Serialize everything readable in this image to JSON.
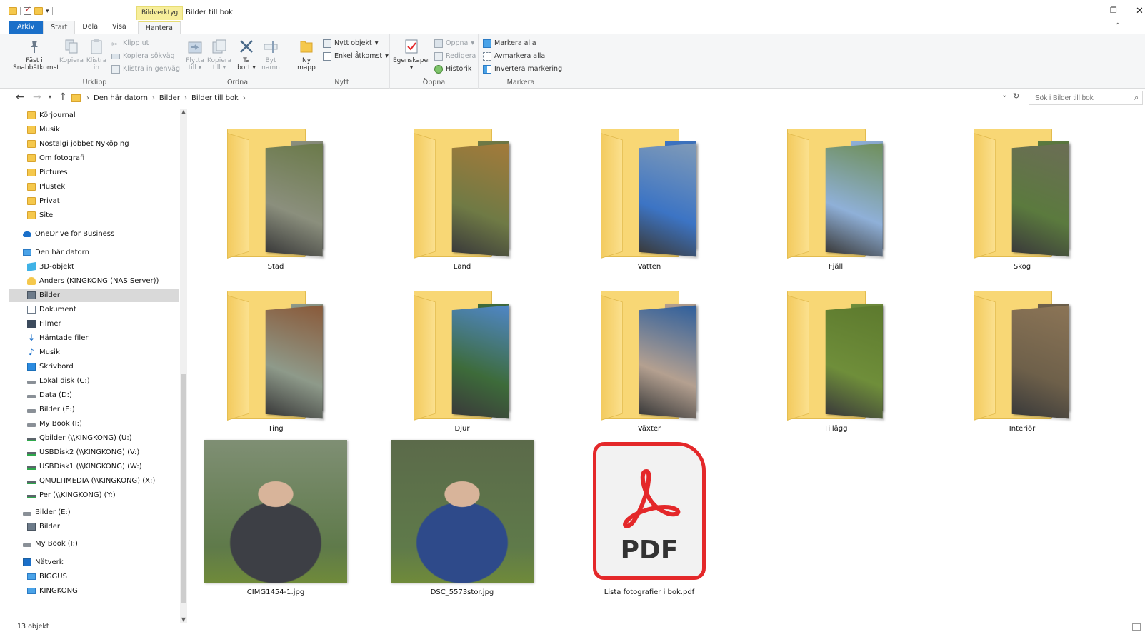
{
  "window": {
    "title": "Bilder till bok",
    "context_tab": "Bildverktyg",
    "minimize": "–",
    "restore": "❐",
    "close": "✕"
  },
  "tabs": [
    "Arkiv",
    "Start",
    "Dela",
    "Visa",
    "Hantera"
  ],
  "ribbon": {
    "urklipp": {
      "label": "Urklipp",
      "pin": "Fäst i Snabbåtkomst",
      "copy": "Kopiera",
      "paste": "Klistra in",
      "cut": "Klipp ut",
      "copy_path": "Kopiera sökväg",
      "paste_shortcut": "Klistra in genväg"
    },
    "ordna": {
      "label": "Ordna",
      "move": "Flytta till",
      "copy_to": "Kopiera till",
      "delete": "Ta bort",
      "rename": "Byt namn"
    },
    "nytt": {
      "label": "Nytt",
      "new_folder": "Ny mapp",
      "new_item": "Nytt objekt",
      "easy_access": "Enkel åtkomst"
    },
    "oppna": {
      "label": "Öppna",
      "properties": "Egenskaper",
      "open": "Öppna",
      "edit": "Redigera",
      "history": "Historik"
    },
    "markera": {
      "label": "Markera",
      "select_all": "Markera alla",
      "select_none": "Avmarkera alla",
      "invert": "Invertera markering"
    }
  },
  "address": {
    "crumbs": [
      "Den här datorn",
      "Bilder",
      "Bilder till bok"
    ],
    "search_placeholder": "Sök i Bilder till bok"
  },
  "nav": [
    {
      "label": "Körjournal",
      "icon": "folder"
    },
    {
      "label": "Musik",
      "icon": "folder"
    },
    {
      "label": "Nostalgi jobbet Nyköping",
      "icon": "folder"
    },
    {
      "label": "Om fotografi",
      "icon": "folder"
    },
    {
      "label": "Pictures",
      "icon": "folder"
    },
    {
      "label": "Plustek",
      "icon": "folder"
    },
    {
      "label": "Privat",
      "icon": "folder"
    },
    {
      "label": "Site",
      "icon": "folder"
    },
    {
      "label": "OneDrive for Business",
      "icon": "cloud"
    },
    {
      "label": "Den här datorn",
      "icon": "pc"
    },
    {
      "label": "3D-objekt",
      "icon": "3d"
    },
    {
      "label": "Anders (KINGKONG (NAS Server))",
      "icon": "net-user"
    },
    {
      "label": "Bilder",
      "icon": "pics"
    },
    {
      "label": "Dokument",
      "icon": "doc"
    },
    {
      "label": "Filmer",
      "icon": "film"
    },
    {
      "label": "Hämtade filer",
      "icon": "down"
    },
    {
      "label": "Musik",
      "icon": "music"
    },
    {
      "label": "Skrivbord",
      "icon": "desk"
    },
    {
      "label": "Lokal disk (C:)",
      "icon": "disk"
    },
    {
      "label": "Data (D:)",
      "icon": "disk"
    },
    {
      "label": "Bilder (E:)",
      "icon": "disk"
    },
    {
      "label": "My Book (I:)",
      "icon": "disk"
    },
    {
      "label": "Qbilder (\\\\KINGKONG) (U:)",
      "icon": "netdisk"
    },
    {
      "label": "USBDisk2 (\\\\KINGKONG) (V:)",
      "icon": "netdisk"
    },
    {
      "label": "USBDisk1 (\\\\KINGKONG) (W:)",
      "icon": "netdisk"
    },
    {
      "label": "QMULTIMEDIA (\\\\KINGKONG) (X:)",
      "icon": "netdisk"
    },
    {
      "label": "Per (\\\\KINGKONG) (Y:)",
      "icon": "netdisk"
    },
    {
      "label": "Bilder (E:)",
      "icon": "disk"
    },
    {
      "label": "Bilder",
      "icon": "pics"
    },
    {
      "label": "My Book (I:)",
      "icon": "disk"
    },
    {
      "label": "Nätverk",
      "icon": "network"
    },
    {
      "label": "BIGGUS",
      "icon": "comp"
    },
    {
      "label": "KINGKONG",
      "icon": "comp"
    }
  ],
  "folders": [
    {
      "name": "Stad",
      "colors": [
        "#6b7a4a",
        "#8b8f7d"
      ]
    },
    {
      "name": "Land",
      "colors": [
        "#a37a3a",
        "#6f7a45"
      ]
    },
    {
      "name": "Vatten",
      "colors": [
        "#7f9ab8",
        "#3c74c4"
      ]
    },
    {
      "name": "Fjäll",
      "colors": [
        "#6f8f5a",
        "#8fb0d8"
      ]
    },
    {
      "name": "Skog",
      "colors": [
        "#6b6d55",
        "#5b7a3e"
      ]
    },
    {
      "name": "Ting",
      "colors": [
        "#8a5a3a",
        "#8e9a8a"
      ]
    },
    {
      "name": "Djur",
      "colors": [
        "#4f86c6",
        "#3d6b3a"
      ]
    },
    {
      "name": "Växter",
      "colors": [
        "#2f5f9c",
        "#b4a090"
      ]
    },
    {
      "name": "Tillägg",
      "colors": [
        "#5d7a2e",
        "#6f8e3a"
      ]
    },
    {
      "name": "Interiör",
      "colors": [
        "#8b7456",
        "#6e604a"
      ]
    }
  ],
  "files": [
    {
      "name": "CIMG1454-1.jpg",
      "colors": [
        "#7f8f74",
        "#3d3f45"
      ]
    },
    {
      "name": "DSC_5573stor.jpg",
      "colors": [
        "#5b6a4a",
        "#2e4a8a"
      ]
    },
    {
      "name": "Lista fotografier i bok.pdf",
      "pdf_label": "PDF"
    }
  ],
  "status": {
    "count": "13 objekt"
  }
}
